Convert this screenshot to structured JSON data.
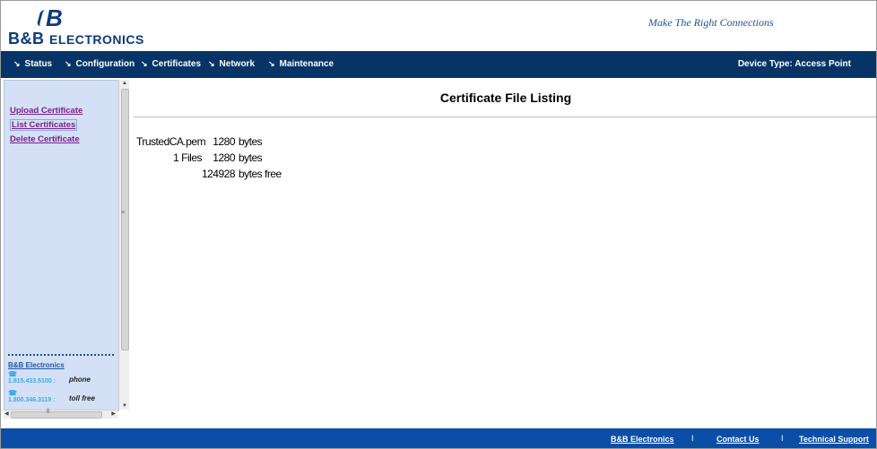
{
  "header": {
    "logo_mark": "B",
    "logo_text_bb": "B&B",
    "logo_text_rest": "ELECTRONICS",
    "tagline": "Make The Right Connections"
  },
  "nav": {
    "items": [
      {
        "label": "Status"
      },
      {
        "label": "Configuration"
      },
      {
        "label": "Certificates"
      },
      {
        "label": "Network"
      },
      {
        "label": "Maintenance"
      }
    ],
    "device_type": "Device Type: Access Point"
  },
  "sidebar": {
    "links": [
      {
        "label": "Upload Certificate",
        "active": false
      },
      {
        "label": "List Certificates",
        "active": true
      },
      {
        "label": "Delete Certificate",
        "active": false
      }
    ],
    "company": "B&B Electronics",
    "contacts": [
      {
        "number": "1.815.433.5100",
        "label": "phone"
      },
      {
        "number": "1.800.346.3119",
        "label": "toll free"
      }
    ]
  },
  "main": {
    "title": "Certificate File Listing",
    "files": [
      {
        "name": "TrustedCA.pem",
        "size": "1280",
        "unit": "bytes"
      }
    ],
    "summary": {
      "count_label": "1 Files",
      "total": "1280",
      "unit": "bytes"
    },
    "free": {
      "value": "124928",
      "unit": "bytes free"
    }
  },
  "footer": {
    "links": [
      "B&B Electronics",
      "Contact Us",
      "Technical Support"
    ],
    "separator": "I"
  },
  "colors": {
    "nav_bg": "#073466",
    "footer_bg": "#0b4ea8",
    "sidebar_bg": "#d3e0f5",
    "link": "#7a1f8f"
  }
}
